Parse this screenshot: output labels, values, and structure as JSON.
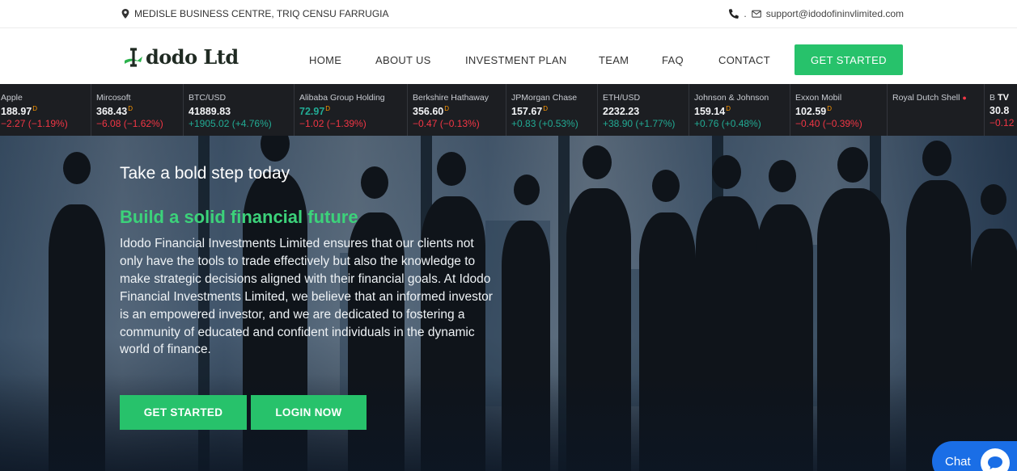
{
  "topbar": {
    "address": "MEDISLE BUSINESS CENTRE, TRIQ CENSU FARRUGIA",
    "separator": ".",
    "email": "support@idodofininvlimited.com"
  },
  "nav": {
    "logo_text": "dodo Ltd",
    "items": [
      {
        "label": "HOME"
      },
      {
        "label": "ABOUT US"
      },
      {
        "label": "INVESTMENT PLAN"
      },
      {
        "label": "TEAM"
      },
      {
        "label": "FAQ"
      },
      {
        "label": "CONTACT"
      }
    ],
    "cta_label": "GET STARTED"
  },
  "ticker": [
    {
      "name": "Apple",
      "price": "188.97",
      "flag": "D",
      "change": "−2.27 (−1.19%)",
      "dir": "neg"
    },
    {
      "name": "Mircosoft",
      "price": "368.43",
      "flag": "D",
      "change": "−6.08 (−1.62%)",
      "dir": "neg"
    },
    {
      "name": "BTC/USD",
      "price": "41889.83",
      "flag": "",
      "change": "+1905.02 (+4.76%)",
      "dir": "pos"
    },
    {
      "name": "Alibaba Group Holding",
      "price": "72.97",
      "flag": "D",
      "change": "−1.02 (−1.39%)",
      "dir": "neg"
    },
    {
      "name": "Berkshire Hathaway",
      "price": "356.60",
      "flag": "D",
      "change": "−0.47 (−0.13%)",
      "dir": "neg"
    },
    {
      "name": "JPMorgan Chase",
      "price": "157.67",
      "flag": "D",
      "change": "+0.83 (+0.53%)",
      "dir": "pos"
    },
    {
      "name": "ETH/USD",
      "price": "2232.23",
      "flag": "",
      "change": "+38.90 (+1.77%)",
      "dir": "pos"
    },
    {
      "name": "Johnson & Johnson",
      "price": "159.14",
      "flag": "D",
      "change": "+0.76 (+0.48%)",
      "dir": "pos"
    },
    {
      "name": "Exxon Mobil",
      "price": "102.59",
      "flag": "D",
      "change": "−0.40 (−0.39%)",
      "dir": "neg"
    },
    {
      "name": "Royal Dutch Shell",
      "price": "",
      "flag": "",
      "change": "",
      "dir": "neg"
    },
    {
      "name": "B",
      "price": "30.8",
      "flag": "",
      "change": "−0.12",
      "dir": "neg"
    }
  ],
  "colors": {
    "accent": "#27c26b",
    "headline": "#3cd27a",
    "ticker_bg": "#1c1e22",
    "negative": "#f23645",
    "positive": "#22ab94",
    "chat": "#1a6ee6"
  },
  "hero": {
    "tagline": "Take a bold step today",
    "headline": "Build a solid financial future",
    "paragraph": "Idodo Financial Investments Limited ensures that our clients not only have the tools to trade effectively but also the knowledge to make strategic decisions aligned with their financial goals. At Idodo Financial Investments Limited, we believe that an informed investor is an empowered investor, and we are dedicated to fostering a community of educated and confident individuals in the dynamic world of finance.",
    "btn_primary": "GET STARTED",
    "btn_secondary": "LOGIN NOW"
  },
  "chat": {
    "label": "Chat"
  }
}
